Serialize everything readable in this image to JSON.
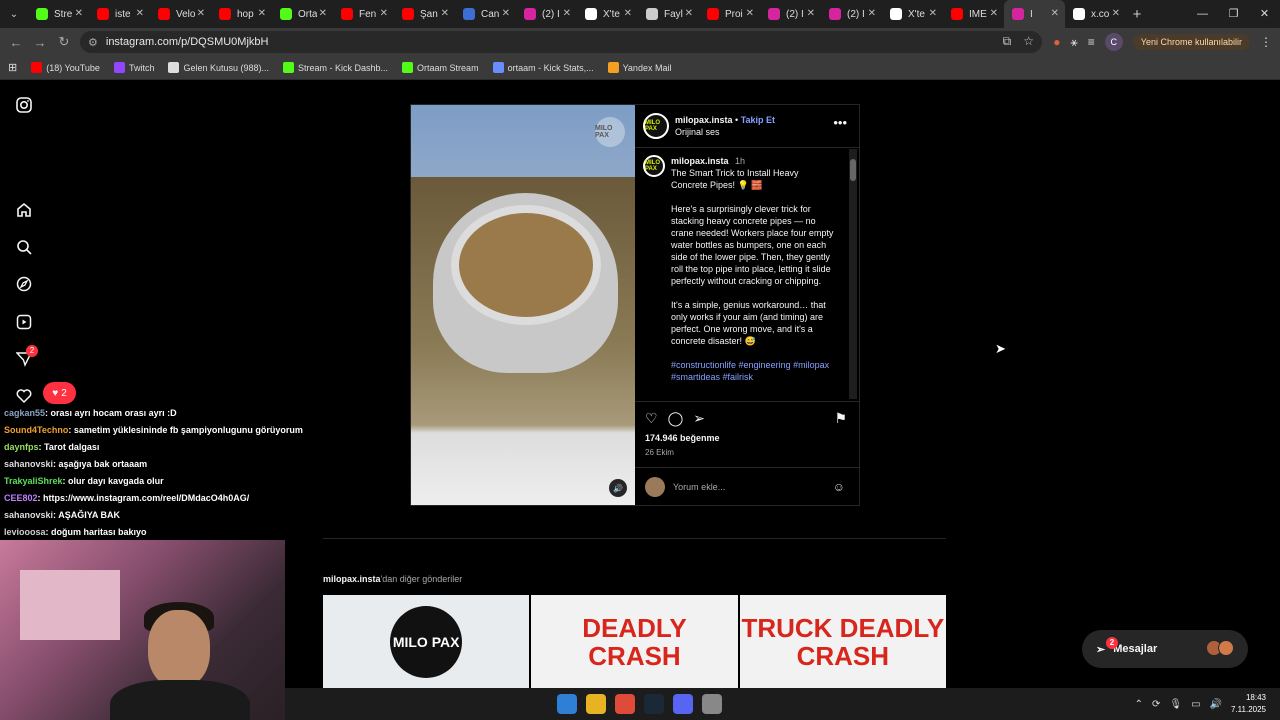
{
  "browser": {
    "tabs": [
      {
        "label": "Stre",
        "favicon_color": "#53fc18",
        "active": false
      },
      {
        "label": "iste",
        "favicon_color": "#ff0000",
        "active": false
      },
      {
        "label": "Velo",
        "favicon_color": "#ff0000",
        "active": false
      },
      {
        "label": "hop",
        "favicon_color": "#ff0000",
        "active": false
      },
      {
        "label": "Orta",
        "favicon_color": "#53fc18",
        "active": false
      },
      {
        "label": "Fen",
        "favicon_color": "#ff0000",
        "active": false
      },
      {
        "label": "Şan",
        "favicon_color": "#ff0000",
        "active": false
      },
      {
        "label": "Can",
        "favicon_color": "#3b6fd4",
        "active": false
      },
      {
        "label": "(2) I",
        "favicon_color": "#d6249f",
        "active": false
      },
      {
        "label": "X'te",
        "favicon_color": "#ffffff",
        "active": false
      },
      {
        "label": "Fayl",
        "favicon_color": "#cccccc",
        "active": false
      },
      {
        "label": "Proi",
        "favicon_color": "#ff0000",
        "active": false
      },
      {
        "label": "(2) I",
        "favicon_color": "#d6249f",
        "active": false
      },
      {
        "label": "(2) I",
        "favicon_color": "#d6249f",
        "active": false
      },
      {
        "label": "X'te",
        "favicon_color": "#ffffff",
        "active": false
      },
      {
        "label": "IME",
        "favicon_color": "#ff0000",
        "active": false
      },
      {
        "label": "I",
        "favicon_color": "#d6249f",
        "active": true
      },
      {
        "label": "x.co",
        "favicon_color": "#ffffff",
        "active": false
      }
    ],
    "url": "instagram.com/p/DQSMU0MjkbH",
    "profile_initial": "C",
    "update_label": "Yeni Chrome kullanılabilir",
    "bookmarks": [
      {
        "label": "(18) YouTube",
        "color": "#ff0000"
      },
      {
        "label": "Twitch",
        "color": "#9146ff"
      },
      {
        "label": "Gelen Kutusu (988)...",
        "color": "#dddddd"
      },
      {
        "label": "Stream - Kick Dashb...",
        "color": "#53fc18"
      },
      {
        "label": "Ortaam Stream",
        "color": "#53fc18"
      },
      {
        "label": "ortaam - Kick Stats,...",
        "color": "#6a8cff"
      },
      {
        "label": "Yandex Mail",
        "color": "#f4a020"
      }
    ]
  },
  "instagram": {
    "nav_badges": {
      "notifications": "2",
      "likes": "2"
    },
    "post": {
      "watermark": "MILO PAX",
      "username": "milopax.insta",
      "separator": "•",
      "follow_label": "Takip Et",
      "audio": "Orijinal ses",
      "avatar_text": "MILO PAX",
      "caption_time": "1h",
      "caption_paragraphs": [
        "The Smart Trick to Install Heavy Concrete Pipes! 💡 🧱",
        "Here's a surprisingly clever trick for stacking heavy concrete pipes — no crane needed! Workers place four empty water bottles as bumpers, one on each side of the lower pipe. Then, they gently roll the top pipe into place, letting it slide perfectly without cracking or chipping.",
        "It's a simple, genius workaround… that only works if your aim (and timing) are perfect. One wrong move, and it's a concrete disaster! 😅"
      ],
      "hashtags": "#constructionlife #engineering #milopax #smartideas #failrisk",
      "likes": "174.946 beğenme",
      "date": "26 Ekim",
      "comment_placeholder": "Yorum ekle..."
    },
    "more_posts": {
      "username": "milopax.insta",
      "suffix": "'dan diğer gönderiler"
    },
    "grid": [
      {
        "text": "MILO PAX"
      },
      {
        "line1": "DEADLY",
        "line2": "CRASH"
      },
      {
        "line1": "TRUCK DEADLY",
        "line2": "CRASH"
      }
    ],
    "messages": {
      "label": "Mesajlar",
      "badge": "2"
    }
  },
  "chat": [
    {
      "user": "cagkan55",
      "color": "#8aa4c0",
      "msg": ": orası ayrı hocam orası ayrı :D"
    },
    {
      "user": "Sound4Techno",
      "color": "#f0a030",
      "msg": ": sametim yüklesininde fb şampiyonlugunu görüyorum"
    },
    {
      "user": "daynfps",
      "color": "#9ae05a",
      "msg": ": Tarot dalgası"
    },
    {
      "user": "sahanovski",
      "color": "#dddddd",
      "msg": ": aşağıya bak ortaaam"
    },
    {
      "user": "TrakyaliShrek",
      "color": "#5ae05a",
      "msg": ": olur dayı kavgada olur"
    },
    {
      "user": "CEE802",
      "color": "#c080ff",
      "msg": ": https://www.instagram.com/reel/DMdacO4h0AG/"
    },
    {
      "user": "sahanovski",
      "color": "#dddddd",
      "msg": ": AŞAĞIYA BAK"
    },
    {
      "user": "leviooosa",
      "color": "#d0d0d0",
      "msg": ": doğum haritası bakıyo"
    }
  ],
  "taskbar": {
    "apps": [
      "#2f7fd6",
      "#e6b422",
      "#e04a3a",
      "#1b2838",
      "#5865f2",
      "#888888"
    ],
    "time": "18:43",
    "date": "7.11.2025"
  }
}
